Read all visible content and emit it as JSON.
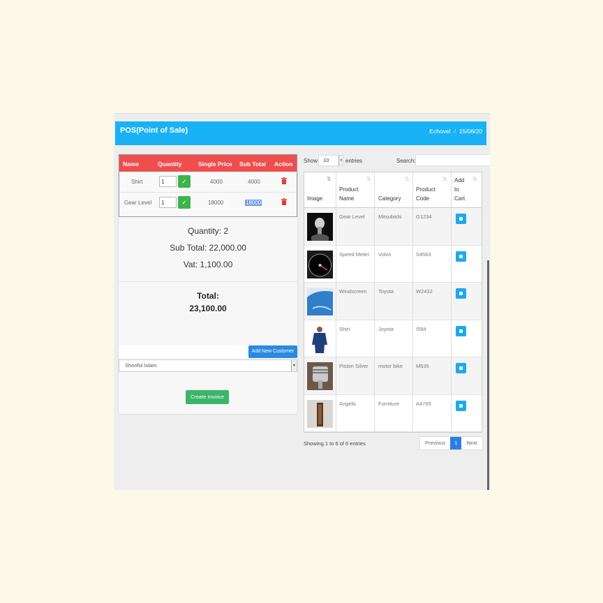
{
  "header": {
    "title": "POS(Point of Sale)",
    "user": "Echovel",
    "date": "15/06/20"
  },
  "cart": {
    "columns": [
      "Name",
      "Quantity",
      "Single Price",
      "Sub Total",
      "Action"
    ],
    "rows": [
      {
        "name": "Shirt",
        "qty": "1",
        "price": "4000",
        "subtotal": "4000"
      },
      {
        "name": "Gear Level",
        "qty": "1",
        "price": "18000",
        "subtotal": "18000"
      }
    ]
  },
  "summary": {
    "quantity": "Quantity: 2",
    "subtotal": "Sub Total: 22,000.00",
    "vat": "Vat: 1,100.00",
    "total_label": "Total:",
    "total_value": "23,100.00"
  },
  "customer": {
    "add_label": "Add New Customer",
    "selected": "Shoriful Islam"
  },
  "invoice_label": "Create Invoice",
  "products": {
    "show_label": "Show",
    "page_size": "10",
    "entries_label": "entries",
    "search_label": "Search:",
    "columns": {
      "image": "Image",
      "name_1": "Product",
      "name_2": "Name",
      "category": "Category",
      "code_1": "Product",
      "code_2": "Code",
      "cart_1": "Add",
      "cart_2": "to",
      "cart_3": "Cart"
    },
    "rows": [
      {
        "name": "Gear Level",
        "category": "Mitsubishi",
        "code": "G1234",
        "thumb": "gear-lever-image"
      },
      {
        "name": "Speed Meter",
        "category": "Volvo",
        "code": "S4563",
        "thumb": "speedometer-image"
      },
      {
        "name": "Windscreen",
        "category": "Toyota",
        "code": "W2432",
        "thumb": "windscreen-image"
      },
      {
        "name": "Shirt",
        "category": "Joyota",
        "code": "I594",
        "thumb": "shirt-image"
      },
      {
        "name": "Piston Silver",
        "category": "motor bike",
        "code": "M535",
        "thumb": "piston-image"
      },
      {
        "name": "Angelic",
        "category": "Furniture",
        "code": "A4765",
        "thumb": "cabinet-image"
      }
    ],
    "info": "Showing 1 to 6 of 6 entries",
    "pager": {
      "prev": "Previous",
      "page": "1",
      "next": "Next"
    }
  },
  "colors": {
    "header": "#19b2f5",
    "cart_head": "#ef4e4e",
    "confirm": "#3bb54a",
    "primary": "#2a8ae2",
    "cart_btn": "#1aaaf0"
  }
}
